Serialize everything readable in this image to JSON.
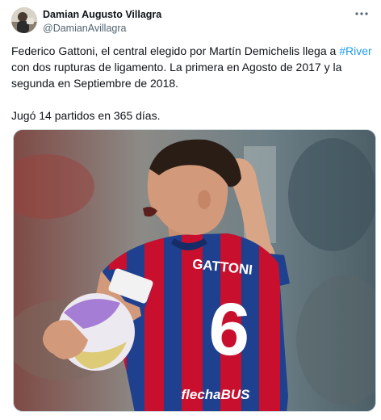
{
  "author": {
    "display_name": "Damian Augusto Villagra",
    "handle": "@DamianAvillagra"
  },
  "post": {
    "text_before": "Federico Gattoni, el central elegido por Martín Demichelis llega a ",
    "hashtag": "#River",
    "text_after": " con dos rupturas de ligamento. La primera en Agosto de 2017 y la segunda en Septiembre de 2018.",
    "second_paragraph": "Jugó 14 partidos en 365 días."
  },
  "media": {
    "shirt_name": "GATTONI",
    "shirt_number": "6",
    "sponsor": "flechaBUS"
  },
  "colors": {
    "link": "#1d9bf0",
    "secondary_text": "#536471",
    "jersey_blue": "#1f3f8f",
    "jersey_red": "#c8102e"
  },
  "icons": {
    "more": "more-horizontal-icon",
    "avatar": "avatar-photo"
  }
}
